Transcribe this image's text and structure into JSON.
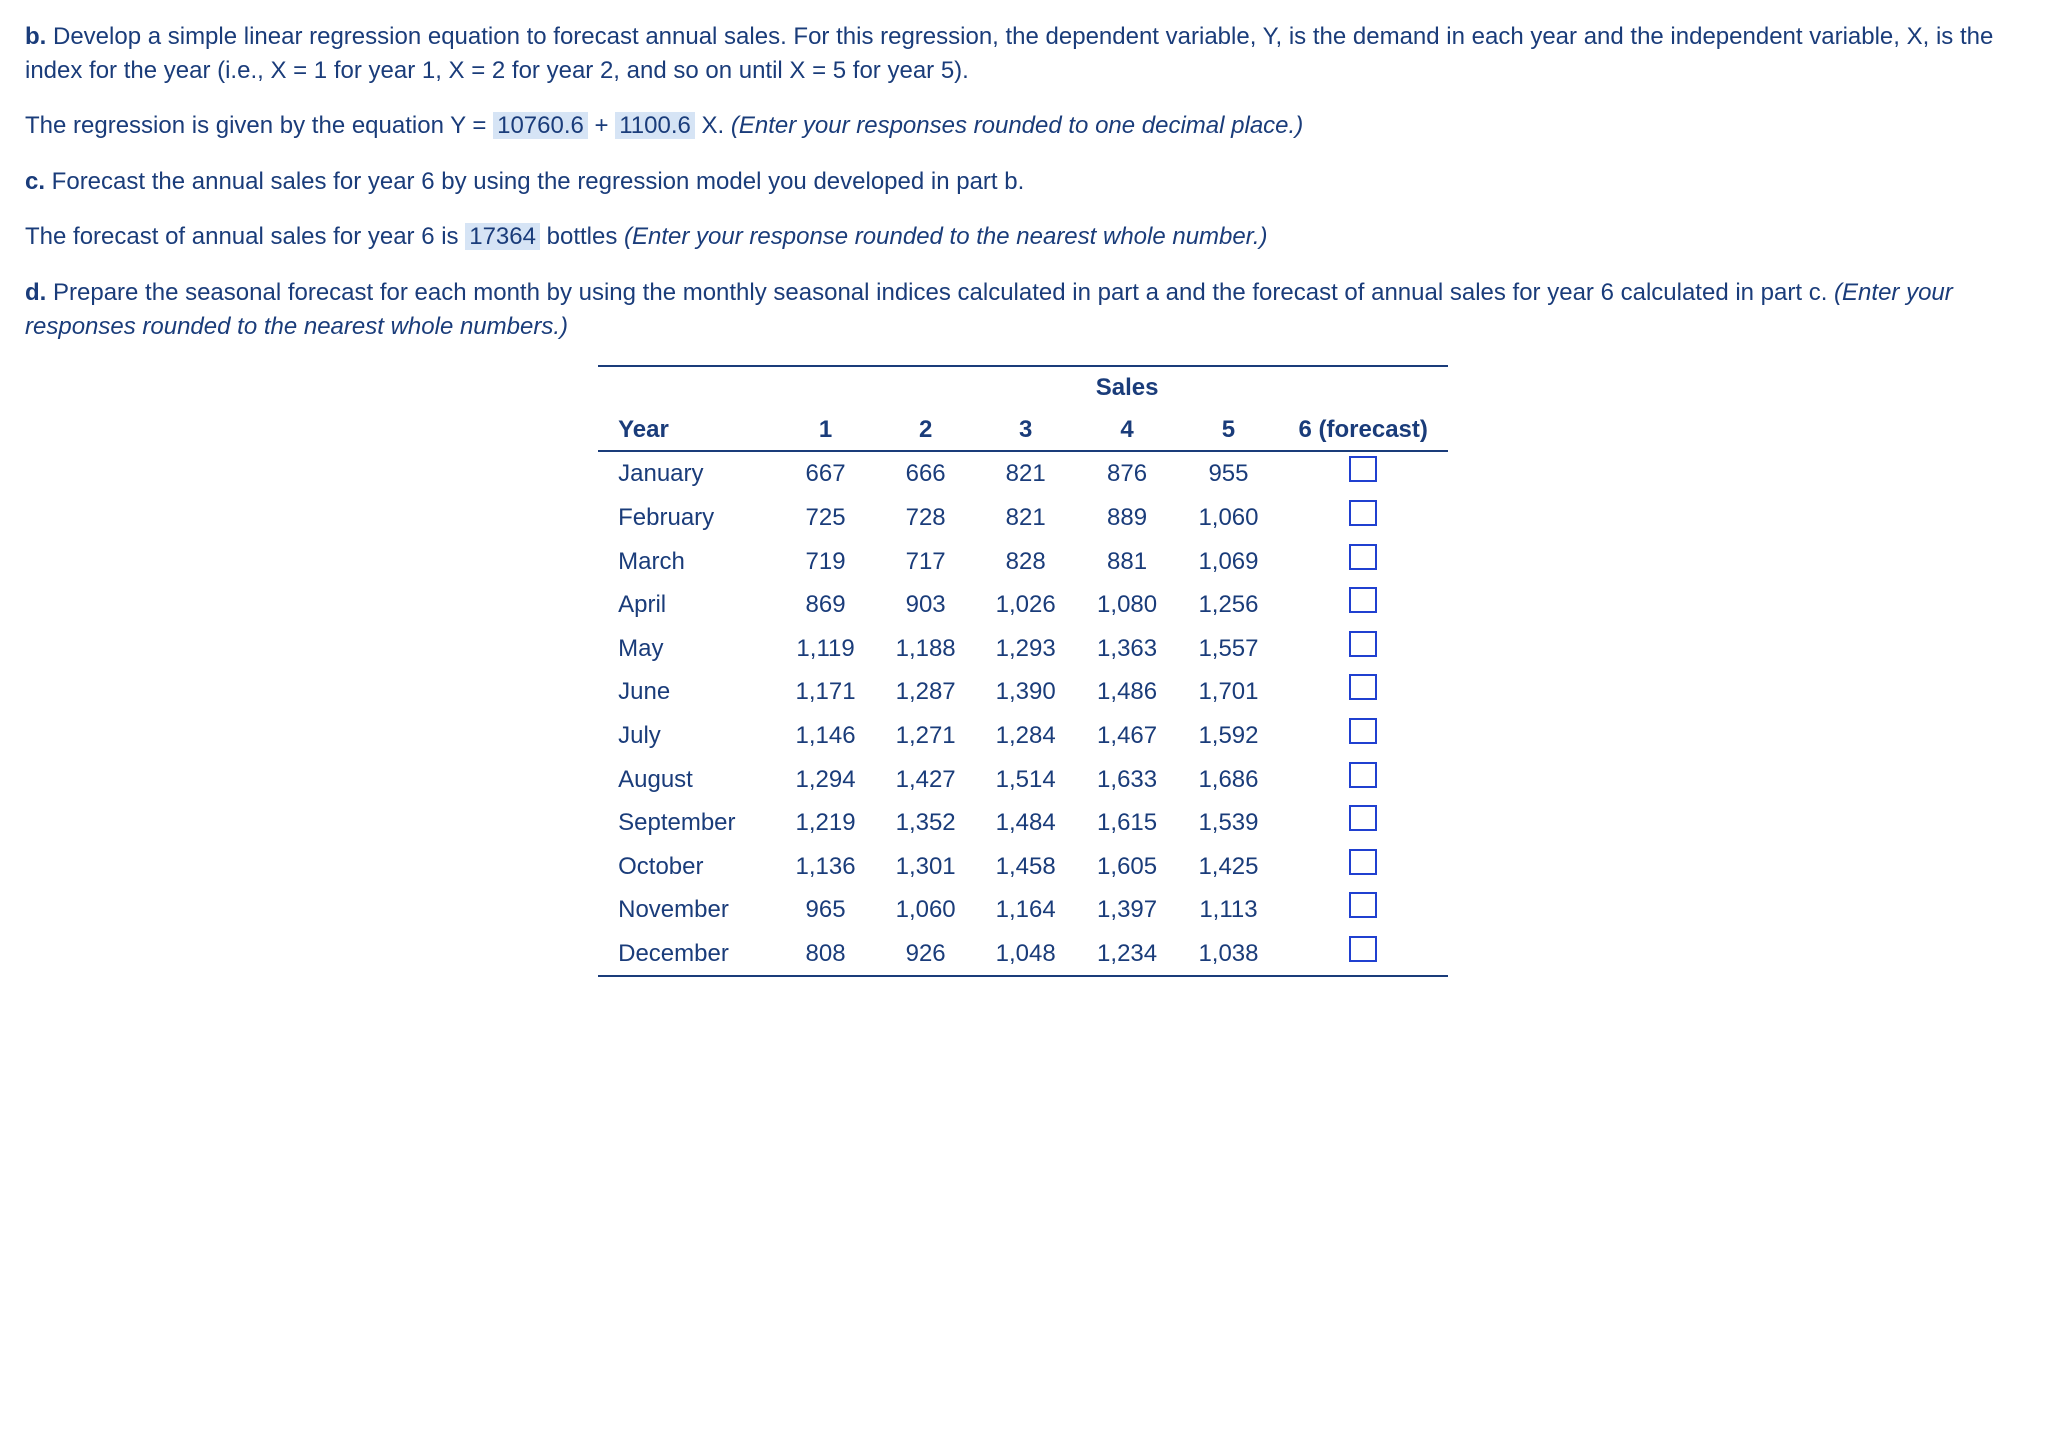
{
  "paragraphs": {
    "b_label": "b.",
    "b_text1": " Develop a simple linear regression equation to forecast annual sales. For this regression, the dependent variable, Y, is the demand in each year and the independent variable, X, is the index for the year (i.e., X = 1 for year 1, X = 2 for year 2, and so on until X = 5 for year 5).",
    "reg_prefix": "The regression is given by the equation Y = ",
    "reg_intercept": "10760.6",
    "reg_plus": " + ",
    "reg_slope": "1100.6",
    "reg_suffix": " X. ",
    "reg_instr": "(Enter your responses rounded to one decimal place.)",
    "c_label": "c.",
    "c_text": " Forecast the annual sales for year 6 by using the regression model you developed in part b.",
    "forecast_prefix": "The forecast of annual sales for year 6 is ",
    "forecast_value": "17364",
    "forecast_suffix": " bottles ",
    "forecast_instr": "(Enter your response rounded to the nearest whole number.)",
    "d_label": "d.",
    "d_text": " Prepare the seasonal forecast for each month by using the monthly seasonal indices calculated in part a and the forecast of annual sales for year 6 calculated in part c. ",
    "d_instr": "(Enter your responses rounded to the nearest whole numbers.)"
  },
  "table": {
    "sales_label": "Sales",
    "year_label": "Year",
    "cols": [
      "1",
      "2",
      "3",
      "4",
      "5",
      "6 (forecast)"
    ],
    "rows": [
      {
        "m": "January",
        "v": [
          "667",
          "666",
          "821",
          "876",
          "955"
        ]
      },
      {
        "m": "February",
        "v": [
          "725",
          "728",
          "821",
          "889",
          "1,060"
        ]
      },
      {
        "m": "March",
        "v": [
          "719",
          "717",
          "828",
          "881",
          "1,069"
        ]
      },
      {
        "m": "April",
        "v": [
          "869",
          "903",
          "1,026",
          "1,080",
          "1,256"
        ]
      },
      {
        "m": "May",
        "v": [
          "1,119",
          "1,188",
          "1,293",
          "1,363",
          "1,557"
        ]
      },
      {
        "m": "June",
        "v": [
          "1,171",
          "1,287",
          "1,390",
          "1,486",
          "1,701"
        ]
      },
      {
        "m": "July",
        "v": [
          "1,146",
          "1,271",
          "1,284",
          "1,467",
          "1,592"
        ]
      },
      {
        "m": "August",
        "v": [
          "1,294",
          "1,427",
          "1,514",
          "1,633",
          "1,686"
        ]
      },
      {
        "m": "September",
        "v": [
          "1,219",
          "1,352",
          "1,484",
          "1,615",
          "1,539"
        ]
      },
      {
        "m": "October",
        "v": [
          "1,136",
          "1,301",
          "1,458",
          "1,605",
          "1,425"
        ]
      },
      {
        "m": "November",
        "v": [
          "965",
          "1,060",
          "1,164",
          "1,397",
          "1,113"
        ]
      },
      {
        "m": "December",
        "v": [
          "808",
          "926",
          "1,048",
          "1,234",
          "1,038"
        ]
      }
    ]
  }
}
